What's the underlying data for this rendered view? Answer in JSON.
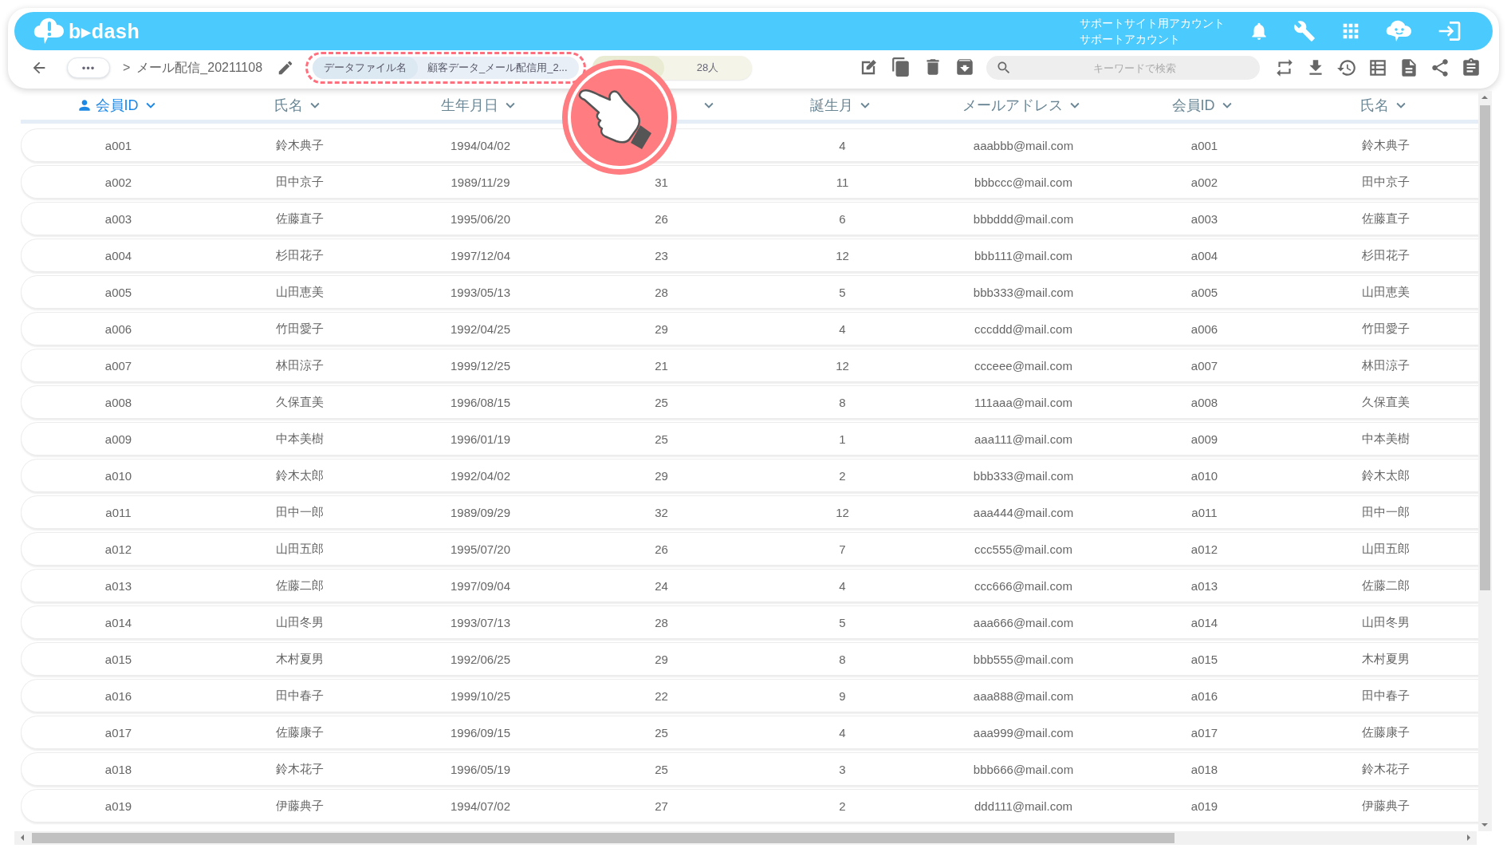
{
  "app_bar": {
    "logo": "b▸dash",
    "account": [
      "サポートサイト用アカウント",
      "サポートアカウント"
    ]
  },
  "toolbar": {
    "more": "•••",
    "separator": ">",
    "title": "メール配信_20211108",
    "file_chip": {
      "label": "データファイル名",
      "value": "顧客データ_メール配信用_2..."
    },
    "count_chip": {
      "value": "28人"
    },
    "search": {
      "placeholder": "キーワードで検索"
    }
  },
  "table": {
    "columns": [
      {
        "label": "会員ID",
        "highlighted": true
      },
      {
        "label": "氏名",
        "highlighted": false
      },
      {
        "label": "生年月日",
        "highlighted": false
      },
      {
        "highlighted": false
      },
      {
        "label": "誕生月",
        "highlighted": false
      },
      {
        "label": "メールアドレス",
        "highlighted": false
      },
      {
        "label": "会員ID",
        "highlighted": false
      },
      {
        "label": "氏名",
        "highlighted": false
      }
    ],
    "rows": [
      {
        "cells": [
          "a001",
          "鈴木典子",
          "1994/04/02",
          null,
          "4",
          "aaabbb@mail.com",
          "a001",
          "鈴木典子"
        ]
      },
      {
        "cells": [
          "a002",
          "田中京子",
          "1989/11/29",
          "31",
          "11",
          "bbbccc@mail.com",
          "a002",
          "田中京子"
        ]
      },
      {
        "cells": [
          "a003",
          "佐藤直子",
          "1995/06/20",
          "26",
          "6",
          "bbbddd@mail.com",
          "a003",
          "佐藤直子"
        ]
      },
      {
        "cells": [
          "a004",
          "杉田花子",
          "1997/12/04",
          "23",
          "12",
          "bbb111@mail.com",
          "a004",
          "杉田花子"
        ]
      },
      {
        "cells": [
          "a005",
          "山田恵美",
          "1993/05/13",
          "28",
          "5",
          "bbb333@mail.com",
          "a005",
          "山田恵美"
        ]
      },
      {
        "cells": [
          "a006",
          "竹田愛子",
          "1992/04/25",
          "29",
          "4",
          "cccddd@mail.com",
          "a006",
          "竹田愛子"
        ]
      },
      {
        "cells": [
          "a007",
          "林田涼子",
          "1999/12/25",
          "21",
          "12",
          "ccceee@mail.com",
          "a007",
          "林田涼子"
        ]
      },
      {
        "cells": [
          "a008",
          "久保直美",
          "1996/08/15",
          "25",
          "8",
          "111aaa@mail.com",
          "a008",
          "久保直美"
        ]
      },
      {
        "cells": [
          "a009",
          "中本美樹",
          "1996/01/19",
          "25",
          "1",
          "aaa111@mail.com",
          "a009",
          "中本美樹"
        ]
      },
      {
        "cells": [
          "a010",
          "鈴木太郎",
          "1992/04/02",
          "29",
          "2",
          "bbb333@mail.com",
          "a010",
          "鈴木太郎"
        ]
      },
      {
        "cells": [
          "a011",
          "田中一郎",
          "1989/09/29",
          "32",
          "12",
          "aaa444@mail.com",
          "a011",
          "田中一郎"
        ]
      },
      {
        "cells": [
          "a012",
          "山田五郎",
          "1995/07/20",
          "26",
          "7",
          "ccc555@mail.com",
          "a012",
          "山田五郎"
        ]
      },
      {
        "cells": [
          "a013",
          "佐藤二郎",
          "1997/09/04",
          "24",
          "4",
          "ccc666@mail.com",
          "a013",
          "佐藤二郎"
        ]
      },
      {
        "cells": [
          "a014",
          "山田冬男",
          "1993/07/13",
          "28",
          "5",
          "aaa666@mail.com",
          "a014",
          "山田冬男"
        ]
      },
      {
        "cells": [
          "a015",
          "木村夏男",
          "1992/06/25",
          "29",
          "8",
          "bbb555@mail.com",
          "a015",
          "木村夏男"
        ]
      },
      {
        "cells": [
          "a016",
          "田中春子",
          "1999/10/25",
          "22",
          "9",
          "aaa888@mail.com",
          "a016",
          "田中春子"
        ]
      },
      {
        "cells": [
          "a017",
          "佐藤康子",
          "1996/09/15",
          "25",
          "4",
          "aaa999@mail.com",
          "a017",
          "佐藤康子"
        ]
      },
      {
        "cells": [
          "a018",
          "鈴木花子",
          "1996/05/19",
          "25",
          "3",
          "bbb666@mail.com",
          "a018",
          "鈴木花子"
        ]
      },
      {
        "cells": [
          "a019",
          "伊藤典子",
          "1994/07/02",
          "27",
          "2",
          "ddd111@mail.com",
          "a019",
          "伊藤典子"
        ]
      }
    ]
  }
}
